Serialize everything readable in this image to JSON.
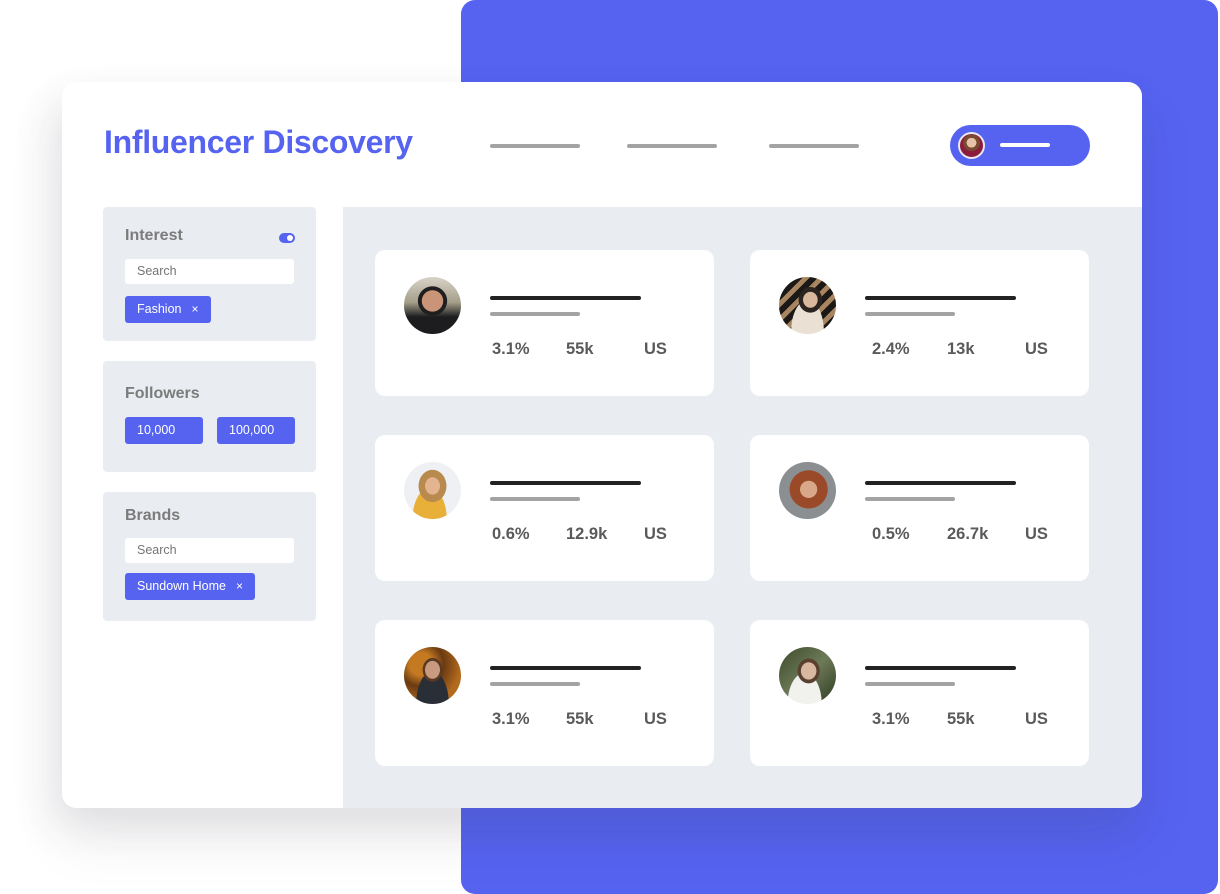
{
  "colors": {
    "accent": "#5563f0",
    "panel_bg": "#e9edf2",
    "stat_text": "#5a5a5a",
    "label_text": "#7b7b7b"
  },
  "header": {
    "title": "Influencer Discovery",
    "nav_items": [
      "placeholder-line",
      "placeholder-line",
      "placeholder-line"
    ],
    "user_menu": {
      "avatar_icon": "user-avatar",
      "label": "placeholder-line"
    }
  },
  "filters": {
    "interest": {
      "label": "Interest",
      "toggle_on": true,
      "search_placeholder": "Search",
      "tags": [
        {
          "label": "Fashion",
          "remove_icon": "×"
        }
      ]
    },
    "followers": {
      "label": "Followers",
      "min": "10,000",
      "max": "100,000"
    },
    "brands": {
      "label": "Brands",
      "search_placeholder": "Search",
      "tags": [
        {
          "label": "Sundown Home",
          "remove_icon": "×"
        }
      ]
    }
  },
  "influencers": [
    {
      "engagement": "3.1%",
      "followers": "55k",
      "country": "US",
      "avatar": "man-smiling-dark-hair"
    },
    {
      "engagement": "2.4%",
      "followers": "13k",
      "country": "US",
      "avatar": "woman-profile-striped-background"
    },
    {
      "engagement": "0.6%",
      "followers": "12.9k",
      "country": "US",
      "avatar": "woman-blonde-yellow-top"
    },
    {
      "engagement": "0.5%",
      "followers": "26.7k",
      "country": "US",
      "avatar": "woman-red-hair"
    },
    {
      "engagement": "3.1%",
      "followers": "55k",
      "country": "US",
      "avatar": "man-leather-jacket-autumn-leaves"
    },
    {
      "engagement": "3.1%",
      "followers": "55k",
      "country": "US",
      "avatar": "woman-resting-chin-on-hand"
    }
  ]
}
